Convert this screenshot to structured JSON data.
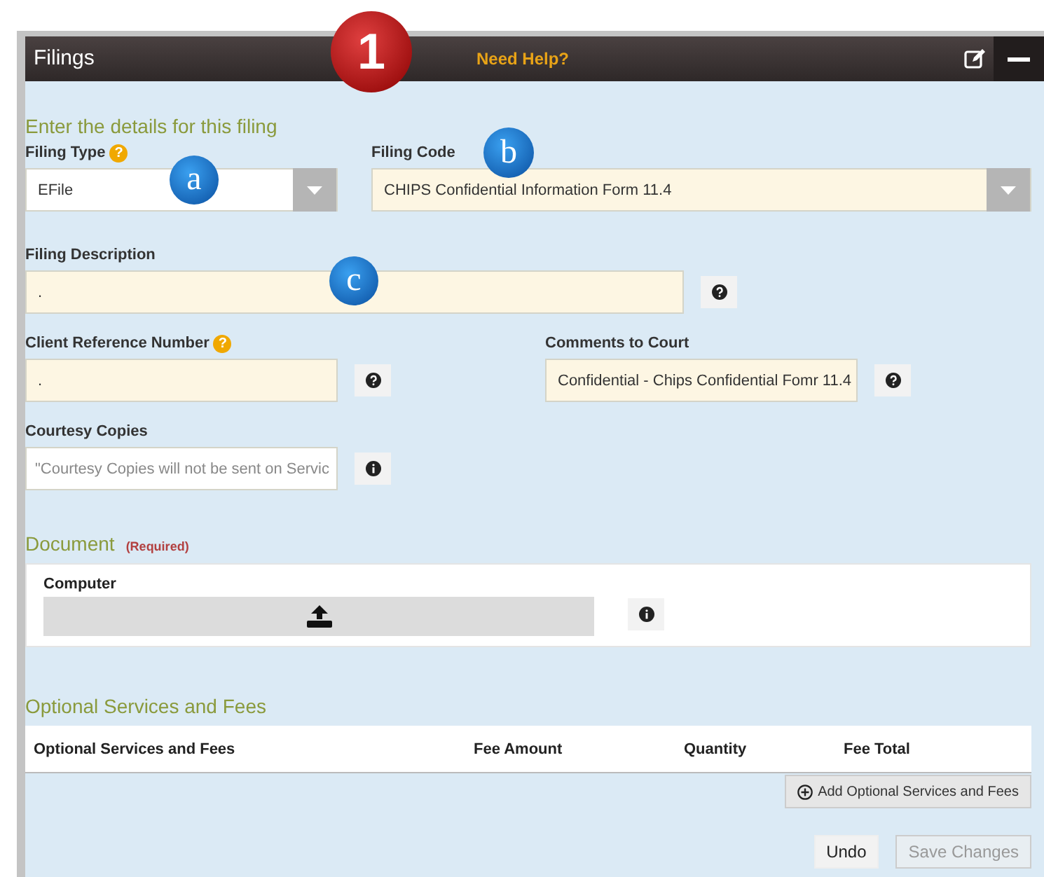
{
  "window": {
    "title": "Filings",
    "help_link": "Need Help?"
  },
  "callouts": [
    {
      "label": "1",
      "kind": "red"
    },
    {
      "label": "a",
      "kind": "blue"
    },
    {
      "label": "b",
      "kind": "blue"
    },
    {
      "label": "c",
      "kind": "blue"
    }
  ],
  "section_title": "Enter the details for this filing",
  "filing_type": {
    "label": "Filing Type",
    "badge": "?",
    "value": "EFile",
    "highlighted": false
  },
  "filing_code": {
    "label": "Filing Code",
    "value": "CHIPS Confidential Information Form 11.4",
    "highlighted": true
  },
  "filing_description": {
    "label": "Filing Description",
    "value": ".",
    "highlighted": true
  },
  "client_reference": {
    "label": "Client Reference Number",
    "badge": "?",
    "value": ".",
    "highlighted": true
  },
  "comments": {
    "label": "Comments to Court",
    "value": "Confidential - Chips Confidential Fomr 11.4",
    "highlighted": true
  },
  "courtesy_copies": {
    "label": "Courtesy Copies",
    "placeholder": "\"Courtesy Copies will not be sent on Servic"
  },
  "document": {
    "heading": "Document",
    "required": "(Required)",
    "source_label": "Computer"
  },
  "fees": {
    "heading": "Optional Services and Fees",
    "columns": [
      "Optional Services and Fees",
      "Fee Amount",
      "Quantity",
      "Fee Total"
    ],
    "add_button": "Add Optional Services and Fees"
  },
  "buttons": [
    {
      "label": "Undo",
      "disabled": false
    },
    {
      "label": "Save Changes",
      "disabled": true
    }
  ]
}
